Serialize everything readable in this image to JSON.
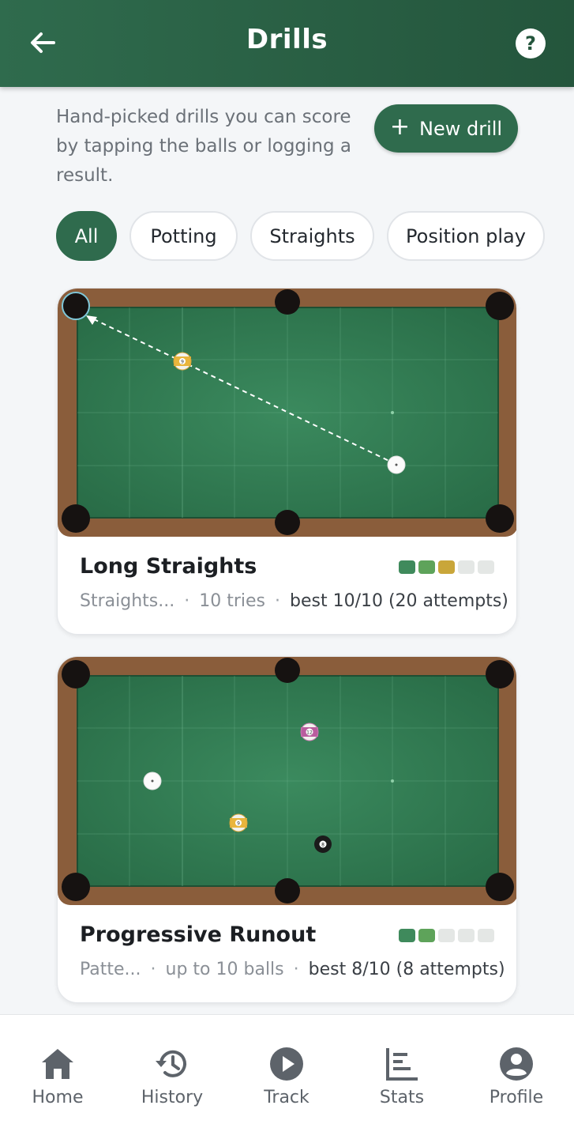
{
  "header": {
    "title": "Drills",
    "back_icon": "arrow-left-icon",
    "help_label": "?"
  },
  "intro": "Hand-picked drills you can score by tapping the balls or logging a result.",
  "new_drill": {
    "plus": "+",
    "label": "New drill"
  },
  "filters": [
    {
      "label": "All",
      "active": true
    },
    {
      "label": "Potting",
      "active": false
    },
    {
      "label": "Straights",
      "active": false
    },
    {
      "label": "Position play",
      "active": false
    }
  ],
  "drills": [
    {
      "name": "Long Straights",
      "category": "Straights...",
      "detail": "10 tries",
      "best": "best 10/10 (20 attempts)",
      "difficulty": [
        "#3f8a5c",
        "#5ea35a",
        "#c9a63a",
        "#e4e7e5",
        "#e4e7e5"
      ],
      "balls": [
        {
          "number": "9"
        }
      ]
    },
    {
      "name": "Progressive Runout",
      "category": "Patte...",
      "detail": "up to 10 balls",
      "best": "best 8/10 (8 attempts)",
      "difficulty": [
        "#3f8a5c",
        "#5ea35a",
        "#e4e7e5",
        "#e4e7e5",
        "#e4e7e5"
      ],
      "balls": [
        {
          "number": "12"
        },
        {
          "number": "9"
        },
        {
          "number": "8"
        }
      ]
    }
  ],
  "nav": [
    {
      "label": "Home",
      "icon": "home-icon"
    },
    {
      "label": "History",
      "icon": "history-icon"
    },
    {
      "label": "Track",
      "icon": "play-circle-icon"
    },
    {
      "label": "Stats",
      "icon": "stats-icon"
    },
    {
      "label": "Profile",
      "icon": "profile-icon"
    }
  ],
  "colors": {
    "brand": "#2f6b4d",
    "felt": "#2f7a50",
    "rail": "#8a5d3b"
  }
}
